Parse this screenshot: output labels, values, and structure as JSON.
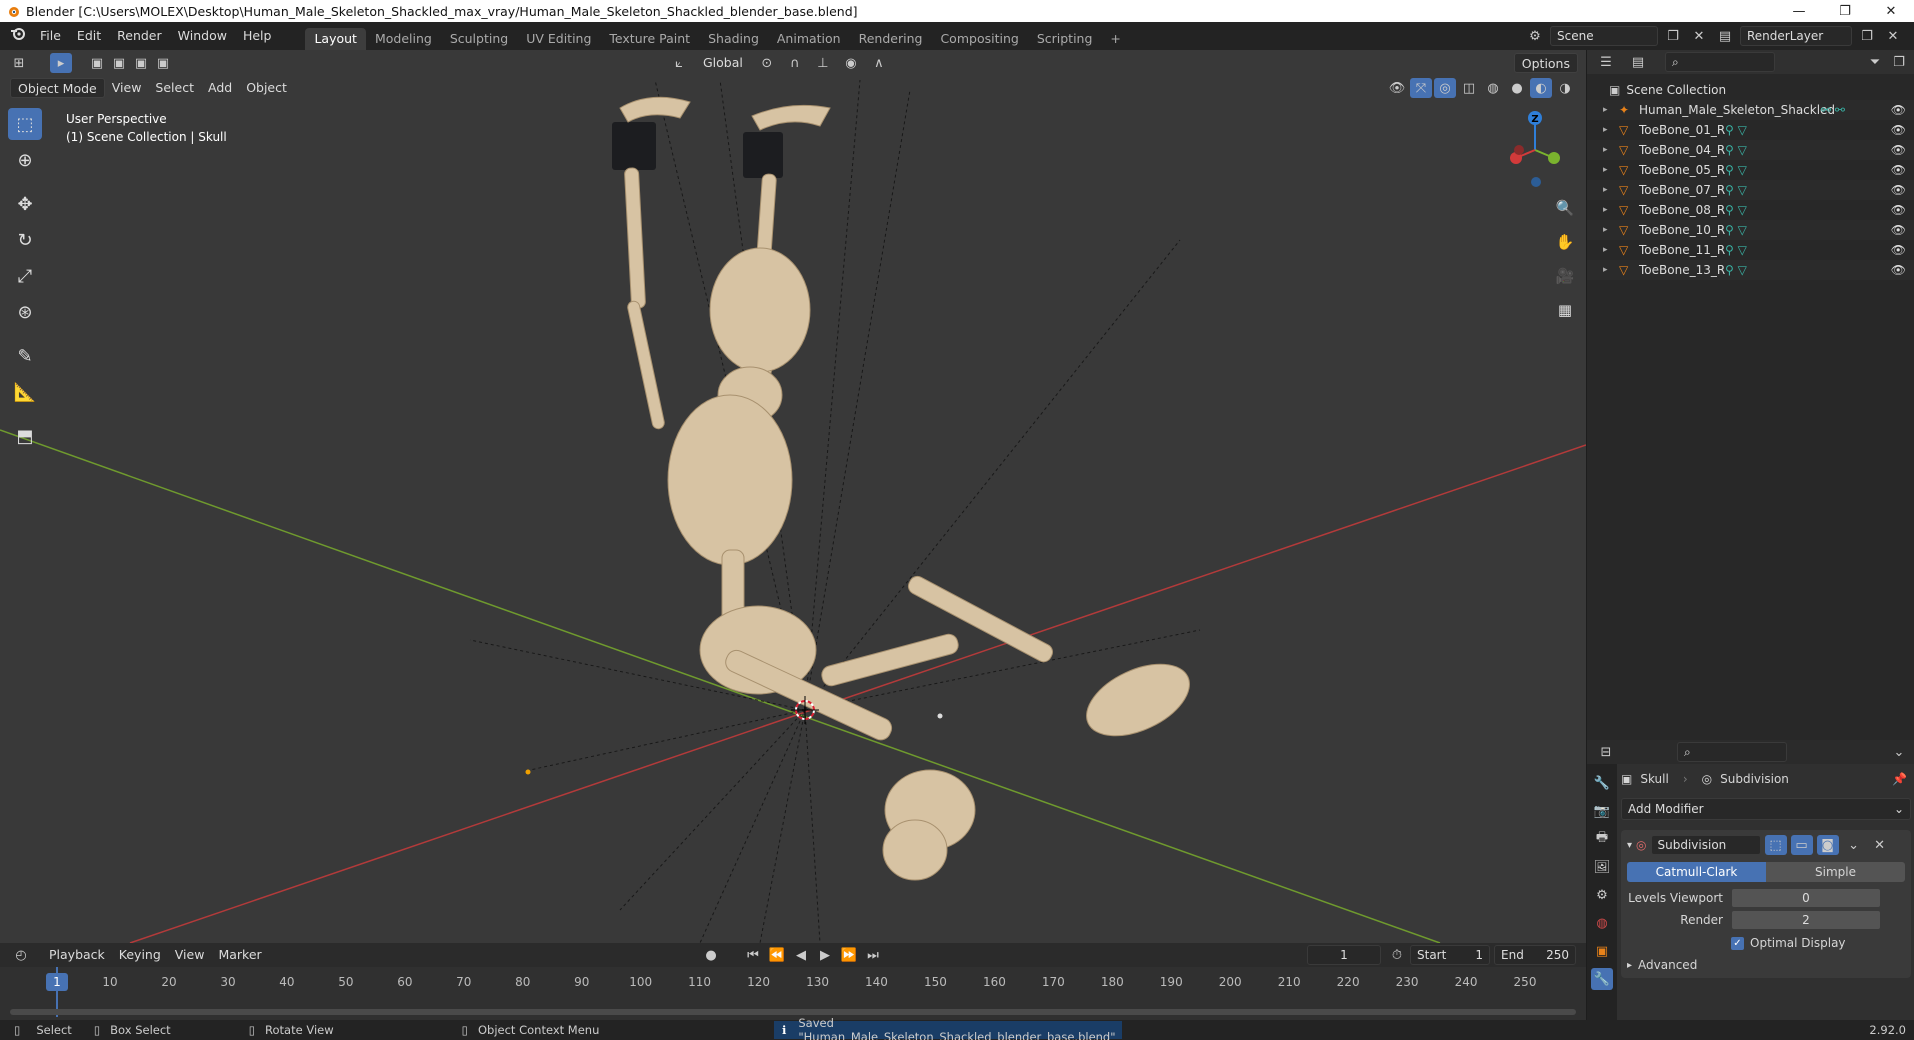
{
  "window": {
    "title": "Blender [C:\\Users\\MOLEX\\Desktop\\Human_Male_Skeleton_Shackled_max_vray/Human_Male_Skeleton_Shackled_blender_base.blend]",
    "minimize": "—",
    "maximize": "❐",
    "close": "✕"
  },
  "menu": {
    "items": [
      "File",
      "Edit",
      "Render",
      "Window",
      "Help"
    ],
    "workspaces": [
      "Layout",
      "Modeling",
      "Sculpting",
      "UV Editing",
      "Texture Paint",
      "Shading",
      "Animation",
      "Rendering",
      "Compositing",
      "Scripting"
    ],
    "active_workspace": "Layout",
    "add_workspace": "+",
    "scene_label": "Scene",
    "render_layer_label": "RenderLayer"
  },
  "viewport": {
    "transform_orientation": "Global",
    "options_label": "Options",
    "mode_label": "Object Mode",
    "menus": [
      "View",
      "Select",
      "Add",
      "Object"
    ],
    "info_line1": "User Perspective",
    "info_line2": "(1) Scene Collection | Skull",
    "gizmo_z": "Z",
    "colors": {
      "background": "#393939",
      "x_axis": "#b33a3a",
      "y_axis": "#6f9a2e",
      "bone": "#d7c3a3"
    }
  },
  "timeline": {
    "menus": [
      "Playback",
      "Keying",
      "View",
      "Marker"
    ],
    "current_frame": "1",
    "start_label": "Start",
    "start_value": "1",
    "end_label": "End",
    "end_value": "250",
    "ticks": [
      "1",
      "10",
      "20",
      "30",
      "40",
      "50",
      "60",
      "70",
      "80",
      "90",
      "100",
      "110",
      "120",
      "130",
      "140",
      "150",
      "160",
      "170",
      "180",
      "190",
      "200",
      "210",
      "220",
      "230",
      "240",
      "250"
    ]
  },
  "status": {
    "select": "Select",
    "box_select": "Box Select",
    "rotate_view": "Rotate View",
    "context_menu": "Object Context Menu",
    "message": "Saved \"Human_Male_Skeleton_Shackled_blender_base.blend\"",
    "version": "2.92.0"
  },
  "outliner": {
    "root": "Scene Collection",
    "items": [
      {
        "name": "Human_Male_Skeleton_Shackled",
        "kind": "armature"
      },
      {
        "name": "ToeBone_01_R",
        "kind": "mesh"
      },
      {
        "name": "ToeBone_04_R",
        "kind": "mesh"
      },
      {
        "name": "ToeBone_05_R",
        "kind": "mesh"
      },
      {
        "name": "ToeBone_07_R",
        "kind": "mesh"
      },
      {
        "name": "ToeBone_08_R",
        "kind": "mesh"
      },
      {
        "name": "ToeBone_10_R",
        "kind": "mesh"
      },
      {
        "name": "ToeBone_11_R",
        "kind": "mesh"
      },
      {
        "name": "ToeBone_13_R",
        "kind": "mesh"
      }
    ]
  },
  "properties": {
    "object_name": "Skull",
    "modifier_breadcrumb": "Subdivision",
    "add_modifier": "Add Modifier",
    "modifier_name": "Subdivision",
    "catmull_clark": "Catmull-Clark",
    "simple": "Simple",
    "levels_viewport_label": "Levels Viewport",
    "levels_viewport_value": "0",
    "render_label": "Render",
    "render_value": "2",
    "optimal_display": "Optimal Display",
    "advanced": "Advanced"
  }
}
